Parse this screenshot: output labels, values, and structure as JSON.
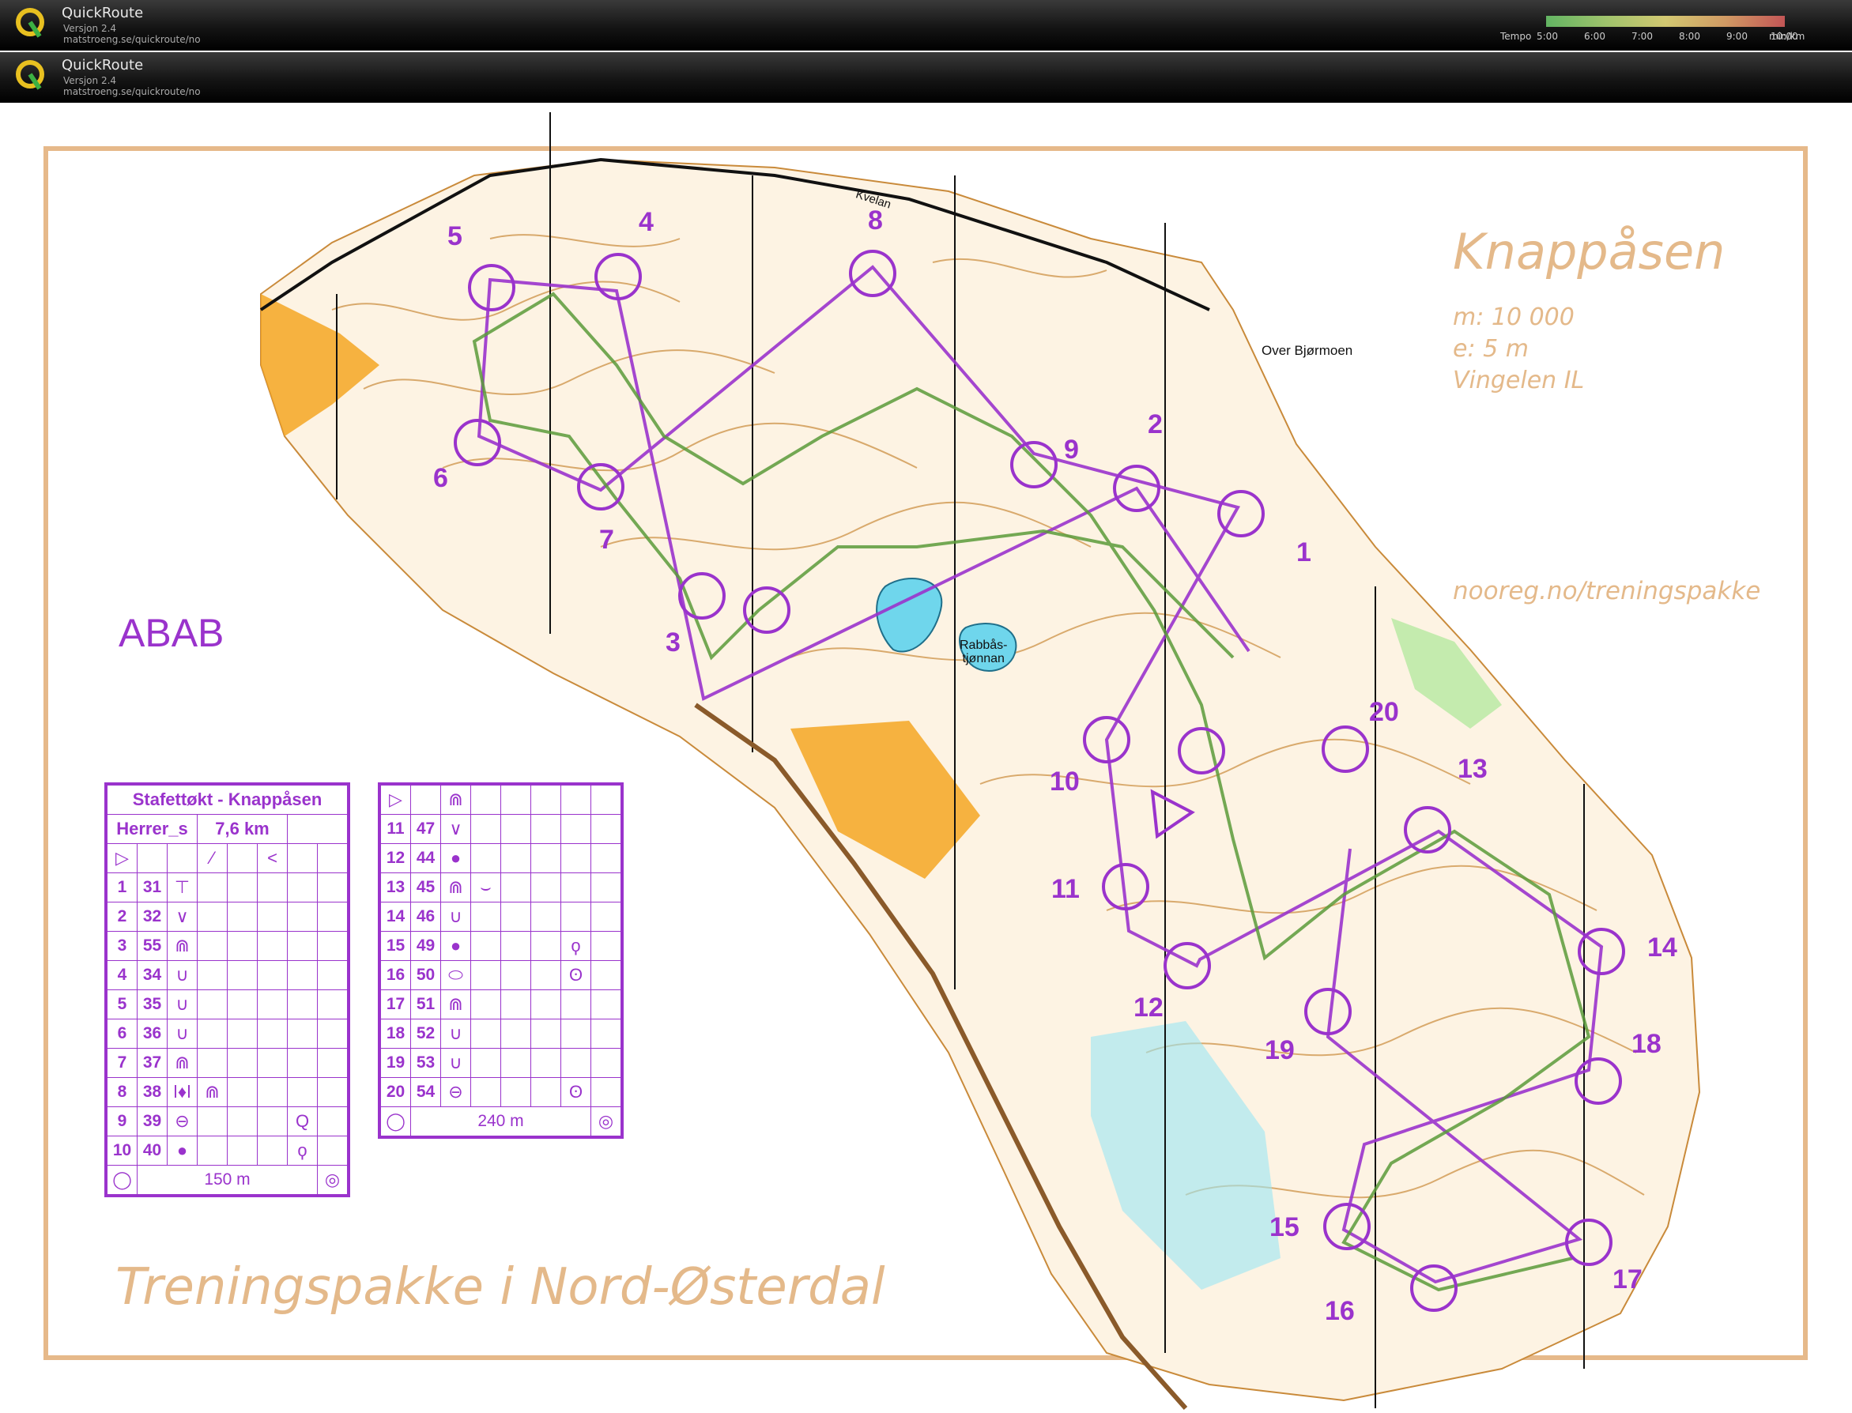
{
  "app": {
    "title": "QuickRoute",
    "version": "Versjon 2.4",
    "url": "matstroeng.se/quickroute/no"
  },
  "tempo": {
    "label": "Tempo",
    "ticks": [
      "5:00",
      "6:00",
      "7:00",
      "8:00",
      "9:00",
      "10:00"
    ],
    "unit": "min/km"
  },
  "map": {
    "title": "Knappåsen",
    "scale_line": "m:  10 000",
    "equidistance_line": "e: 5 m",
    "club_line": "Vingelen IL",
    "url": "nooreg.no/treningspakke",
    "place_label": "Over Bjørmoen",
    "road_label": "Kvelan",
    "lake_label_1": "Rabbås-",
    "lake_label_2": "tjønnan",
    "variant": "ABAB",
    "footer_title": "Treningspakke i Nord-Østerdal",
    "colors": {
      "course": "#9a33cc",
      "contour": "#c98a3a",
      "open": "#f5a623",
      "water": "#6fd6ec",
      "border": "#e6b98a"
    }
  },
  "controls": [
    {
      "num": "1"
    },
    {
      "num": "2"
    },
    {
      "num": "3"
    },
    {
      "num": "4"
    },
    {
      "num": "5"
    },
    {
      "num": "6"
    },
    {
      "num": "7"
    },
    {
      "num": "8"
    },
    {
      "num": "9"
    },
    {
      "num": "10"
    },
    {
      "num": "11"
    },
    {
      "num": "12"
    },
    {
      "num": "13"
    },
    {
      "num": "14"
    },
    {
      "num": "15"
    },
    {
      "num": "16"
    },
    {
      "num": "17"
    },
    {
      "num": "18"
    },
    {
      "num": "19"
    },
    {
      "num": "20"
    }
  ],
  "description_sheet": {
    "title": "Stafettøkt - Knappåsen",
    "class": "Herrer_s",
    "length": "7,6 km",
    "rows_left": [
      {
        "n": "1",
        "code": "31",
        "sym": "⊤",
        "extra": ""
      },
      {
        "n": "2",
        "code": "32",
        "sym": "∨",
        "extra": ""
      },
      {
        "n": "3",
        "code": "55",
        "sym": "⋒",
        "extra": ""
      },
      {
        "n": "4",
        "code": "34",
        "sym": "∪",
        "extra": ""
      },
      {
        "n": "5",
        "code": "35",
        "sym": "∪",
        "extra": ""
      },
      {
        "n": "6",
        "code": "36",
        "sym": "∪",
        "extra": ""
      },
      {
        "n": "7",
        "code": "37",
        "sym": "⋒",
        "extra": ""
      },
      {
        "n": "8",
        "code": "38",
        "sym": "⋒",
        "extra": ""
      },
      {
        "n": "9",
        "code": "39",
        "sym": "⊖",
        "extra": "Q"
      },
      {
        "n": "10",
        "code": "40",
        "sym": "●",
        "extra": "ϙ"
      }
    ],
    "rows_right": [
      {
        "n": "11",
        "code": "47",
        "sym": "∨",
        "extra": ""
      },
      {
        "n": "12",
        "code": "44",
        "sym": "●",
        "extra": ""
      },
      {
        "n": "13",
        "code": "45",
        "sym": "⋒",
        "extra": ""
      },
      {
        "n": "14",
        "code": "46",
        "sym": "∪",
        "extra": ""
      },
      {
        "n": "15",
        "code": "49",
        "sym": "●",
        "extra": "ϙ"
      },
      {
        "n": "16",
        "code": "50",
        "sym": "⬭",
        "extra": "ʘ"
      },
      {
        "n": "17",
        "code": "51",
        "sym": "⋒",
        "extra": ""
      },
      {
        "n": "18",
        "code": "52",
        "sym": "∪",
        "extra": ""
      },
      {
        "n": "19",
        "code": "53",
        "sym": "∪",
        "extra": ""
      },
      {
        "n": "20",
        "code": "54",
        "sym": "⊖",
        "extra": "ʘ"
      }
    ],
    "footer_left": "150 m",
    "footer_right": "240 m"
  }
}
